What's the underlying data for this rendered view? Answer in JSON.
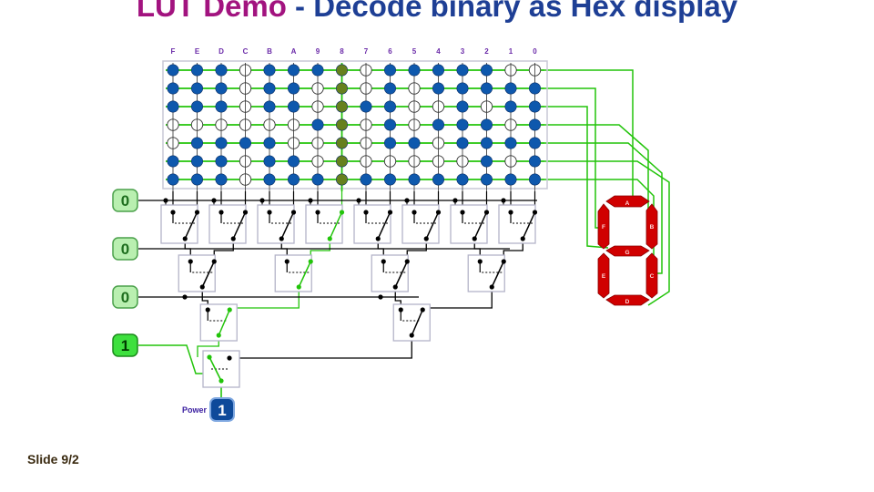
{
  "title": {
    "part1": "LUT Demo",
    "part2": " - Decode binary as Hex display"
  },
  "slide_number": "Slide 9/2",
  "columns": [
    "F",
    "E",
    "D",
    "C",
    "B",
    "A",
    "9",
    "8",
    "7",
    "6",
    "5",
    "4",
    "3",
    "2",
    "1",
    "0"
  ],
  "selected_column": "8",
  "segment_rows": [
    "A",
    "B",
    "G",
    "C",
    "D",
    "E",
    "F"
  ],
  "matrix": [
    [
      1,
      1,
      1,
      0,
      1,
      1,
      1,
      1,
      0,
      1,
      1,
      1,
      1,
      1,
      0,
      0
    ],
    [
      1,
      1,
      1,
      0,
      1,
      1,
      0,
      1,
      0,
      1,
      0,
      1,
      1,
      1,
      1,
      1
    ],
    [
      1,
      1,
      1,
      0,
      1,
      1,
      0,
      1,
      1,
      1,
      0,
      0,
      1,
      0,
      1,
      1
    ],
    [
      0,
      0,
      0,
      0,
      0,
      0,
      1,
      1,
      0,
      1,
      0,
      1,
      1,
      1,
      0,
      1
    ],
    [
      0,
      1,
      1,
      1,
      1,
      0,
      0,
      1,
      0,
      1,
      1,
      0,
      1,
      1,
      1,
      1
    ],
    [
      1,
      1,
      1,
      0,
      1,
      1,
      0,
      1,
      0,
      0,
      0,
      0,
      0,
      1,
      0,
      1
    ],
    [
      1,
      1,
      1,
      0,
      1,
      1,
      1,
      1,
      1,
      1,
      1,
      1,
      1,
      1,
      1,
      1
    ]
  ],
  "inputs": [
    {
      "name": "bit0",
      "value": "0"
    },
    {
      "name": "bit1",
      "value": "0"
    },
    {
      "name": "bit2",
      "value": "0"
    },
    {
      "name": "bit3",
      "value": "1"
    }
  ],
  "power": {
    "label": "Power",
    "value": "1"
  },
  "display": {
    "segments_lit": [
      "A",
      "B",
      "C",
      "D",
      "E",
      "F",
      "G"
    ]
  },
  "colors": {
    "wire_on": "#22c40a",
    "wire_off": "#000000",
    "node_on": "#0e58ad",
    "node_sel": "#66801e",
    "segment": "#d00000",
    "input_off_bg": "#b9efb0",
    "input_on_bg": "#3ee03e",
    "power_bg": "#0e4a9a"
  }
}
